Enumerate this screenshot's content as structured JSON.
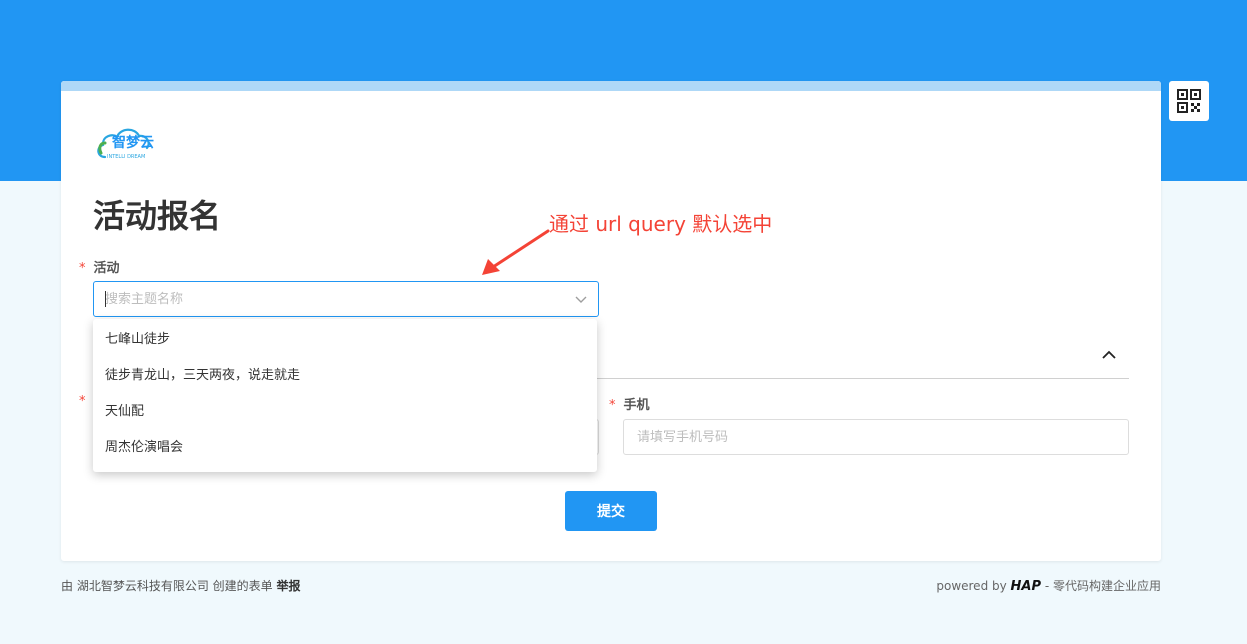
{
  "logo": {
    "text": "智梦云",
    "subtext": "INTELLI DREAM"
  },
  "form": {
    "title": "活动报名",
    "required_mark": "*",
    "activity": {
      "label": "活动",
      "placeholder": "搜索主题名称",
      "options": [
        "七峰山徒步",
        "徒步青龙山，三天两夜，说走就走",
        "天仙配",
        "周杰伦演唱会"
      ]
    },
    "phone": {
      "label": "手机",
      "placeholder": "请填写手机号码"
    },
    "submit_label": "提交"
  },
  "annotation": {
    "text": "通过 url query 默认选中",
    "color": "#f44336"
  },
  "footer": {
    "left_prefix": "由 湖北智梦云科技有限公司 创建的表单",
    "report_label": "举报",
    "right_prefix": "powered by",
    "brand": "HAP",
    "right_suffix": "- 零代码构建企业应用"
  },
  "colors": {
    "primary": "#2196f3",
    "accent_light": "#aed8f7",
    "required": "#f44336"
  },
  "icons": [
    "qr-code-icon",
    "chevron-down-icon",
    "chevron-up-icon"
  ]
}
